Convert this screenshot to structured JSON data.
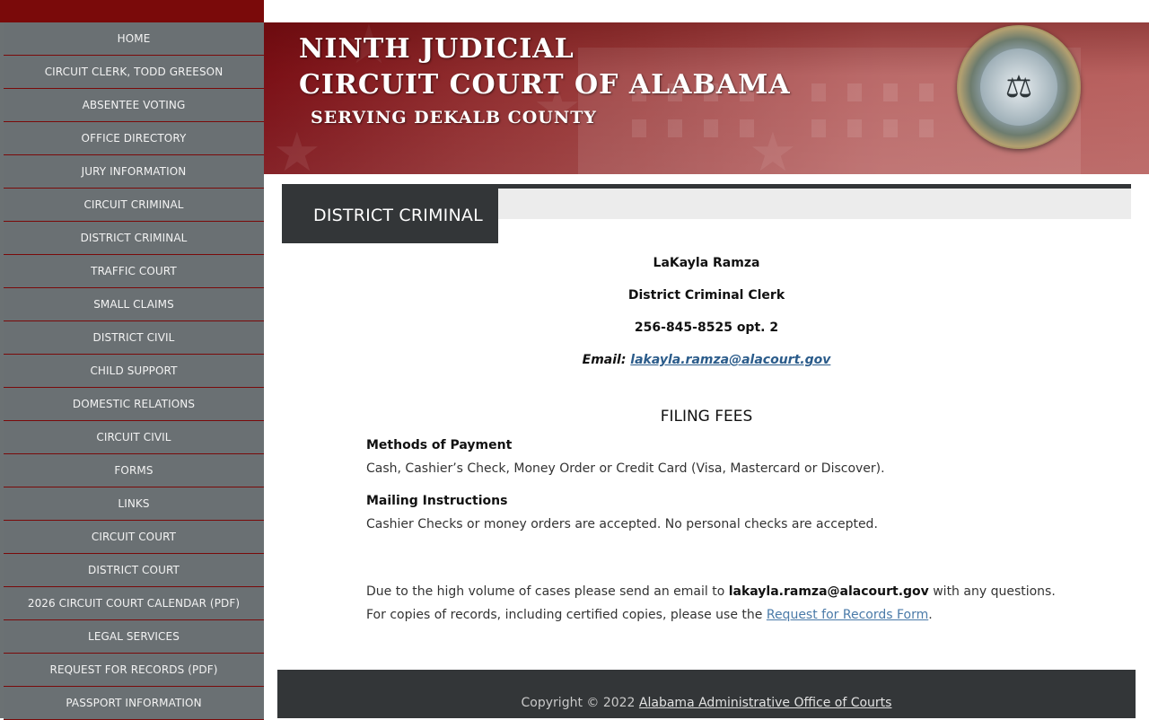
{
  "sidebar": {
    "items": [
      {
        "label": "HOME"
      },
      {
        "label": "CIRCUIT CLERK, TODD GREESON"
      },
      {
        "label": "ABSENTEE VOTING"
      },
      {
        "label": "OFFICE DIRECTORY"
      },
      {
        "label": "JURY INFORMATION"
      },
      {
        "label": "CIRCUIT CRIMINAL"
      },
      {
        "label": "DISTRICT CRIMINAL"
      },
      {
        "label": "TRAFFIC COURT"
      },
      {
        "label": "SMALL CLAIMS"
      },
      {
        "label": "DISTRICT CIVIL"
      },
      {
        "label": "CHILD SUPPORT"
      },
      {
        "label": "DOMESTIC RELATIONS"
      },
      {
        "label": "CIRCUIT CIVIL"
      },
      {
        "label": "FORMS"
      },
      {
        "label": "LINKS"
      },
      {
        "label": "CIRCUIT COURT"
      },
      {
        "label": "DISTRICT COURT"
      },
      {
        "label": "2026 CIRCUIT COURT CALENDAR (PDF)"
      },
      {
        "label": "LEGAL SERVICES"
      },
      {
        "label": "REQUEST FOR RECORDS (PDF)"
      },
      {
        "label": "PASSPORT INFORMATION"
      }
    ]
  },
  "header": {
    "line1": "NINTH  JUDICIAL",
    "line2": "CIRCUIT COURT OF ALABAMA",
    "line3": "SERVING DEKALB COUNTY",
    "seal_icon": "scales-of-justice-icon"
  },
  "page": {
    "title": "DISTRICT CRIMINAL"
  },
  "contact": {
    "name": "LaKayla Ramza",
    "role": "District Criminal Clerk",
    "phone": "256-845-8525 opt. 2",
    "email_label": "Email:",
    "email": "lakayla.ramza@alacourt.gov"
  },
  "fees": {
    "heading": "FILING FEES",
    "methods_heading": "Methods of Payment",
    "methods_text": "Cash, Cashier’s Check, Money Order or Credit Card (Visa, Mastercard or Discover).",
    "mailing_heading": "Mailing Instructions",
    "mailing_text": "Cashier Checks or money orders are accepted.  No personal checks are accepted."
  },
  "notice": {
    "pre": "Due to the high volume of cases please send an email to ",
    "email": "lakayla.ramza@alacourt.gov",
    "mid": " with any questions.  For copies of records, including certified copies, please use the ",
    "link": "Request for Records Form",
    "post": "."
  },
  "footer": {
    "copyright": "Copyright © 2022 ",
    "link": "Alabama Administrative Office of Courts"
  }
}
